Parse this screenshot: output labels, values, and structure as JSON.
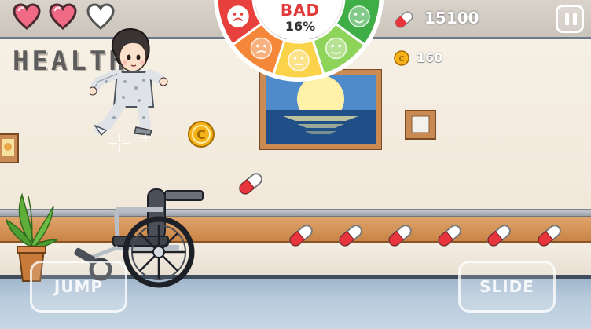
{
  "hud": {
    "hearts": [
      {
        "state": "full",
        "color": "#f06a86"
      },
      {
        "state": "full",
        "color": "#f06a86"
      },
      {
        "state": "empty",
        "color": "#555555"
      }
    ],
    "mood": {
      "label": "BAD",
      "percent": "16%",
      "percent_value": 16,
      "segments": [
        {
          "face": "very-sad",
          "color": "#e8403d"
        },
        {
          "face": "sad",
          "color": "#f5873a"
        },
        {
          "face": "neutral",
          "color": "#fbd34a"
        },
        {
          "face": "happy",
          "color": "#8ed35a"
        },
        {
          "face": "very-happy",
          "color": "#3fae47"
        }
      ]
    },
    "pills": {
      "count": "15100",
      "icon": "pill-icon"
    },
    "coins": {
      "count": "160",
      "icon": "coin-icon"
    },
    "pause": {
      "icon": "pause-icon"
    }
  },
  "scene": {
    "wall_sign": "HEALTH",
    "pickup_coin_letter": "C"
  },
  "controls": {
    "jump_label": "JUMP",
    "slide_label": "SLIDE"
  },
  "colors": {
    "accent_red": "#e23a3a",
    "pill_red": "#e8343d",
    "coin_gold": "#f5b21a"
  }
}
